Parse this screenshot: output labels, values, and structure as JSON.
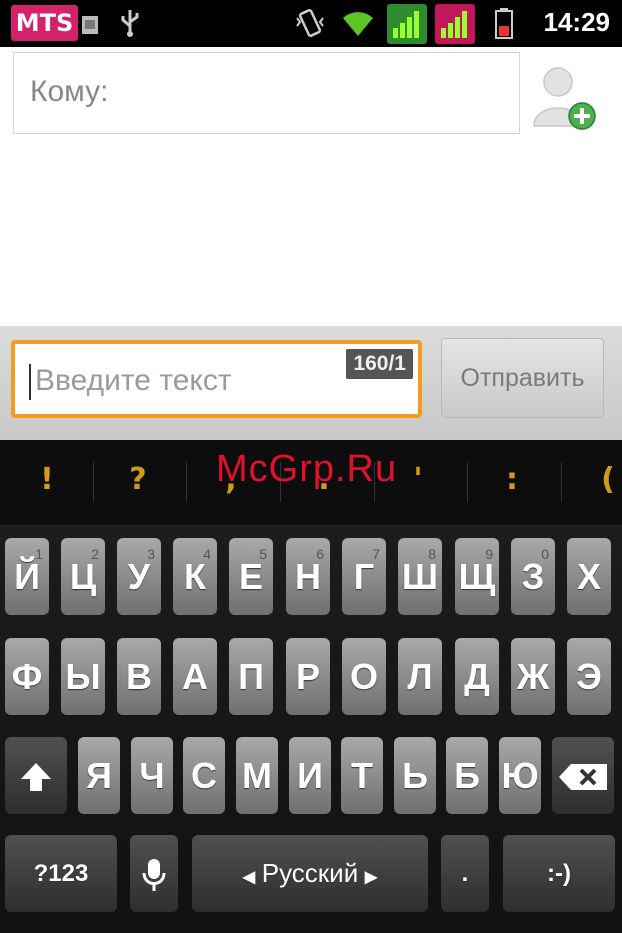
{
  "status_bar": {
    "carrier": "MTS",
    "time": "14:29",
    "icons": [
      "sim-card-icon",
      "usb-icon",
      "vibrate-icon",
      "wifi-icon",
      "signal-icon",
      "signal-icon",
      "battery-icon"
    ]
  },
  "recipient": {
    "label": "Кому:",
    "add_contact_icon": "add-contact-icon"
  },
  "compose": {
    "placeholder": "Введите текст",
    "counter": "160/1",
    "send_label": "Отправить"
  },
  "watermark": "McGrp.Ru",
  "suggestions": [
    "!",
    "?",
    ",",
    ".",
    "'",
    ":",
    "("
  ],
  "keyboard": {
    "row1": [
      "Й",
      "Ц",
      "У",
      "К",
      "Е",
      "Н",
      "Г",
      "Ш",
      "Щ",
      "З",
      "Х"
    ],
    "row1_hints": [
      "1",
      "2",
      "3",
      "4",
      "5",
      "6",
      "7",
      "8",
      "9",
      "0",
      ""
    ],
    "row2": [
      "Ф",
      "Ы",
      "В",
      "А",
      "П",
      "Р",
      "О",
      "Л",
      "Д",
      "Ж",
      "Э"
    ],
    "row3": [
      "Я",
      "Ч",
      "С",
      "М",
      "И",
      "Т",
      "Ь",
      "Б",
      "Ю"
    ],
    "numbers_label": "?123",
    "language_label": "Русский",
    "period_label": ".",
    "smiley_label": ":-)",
    "shift_icon": "shift-icon",
    "backspace_icon": "backspace-icon",
    "mic_icon": "microphone-icon"
  },
  "colors": {
    "carrier_badge": "#d4216b",
    "input_focus": "#f39c1e",
    "suggestion_text": "#d49a14",
    "watermark": "#e0102e"
  }
}
